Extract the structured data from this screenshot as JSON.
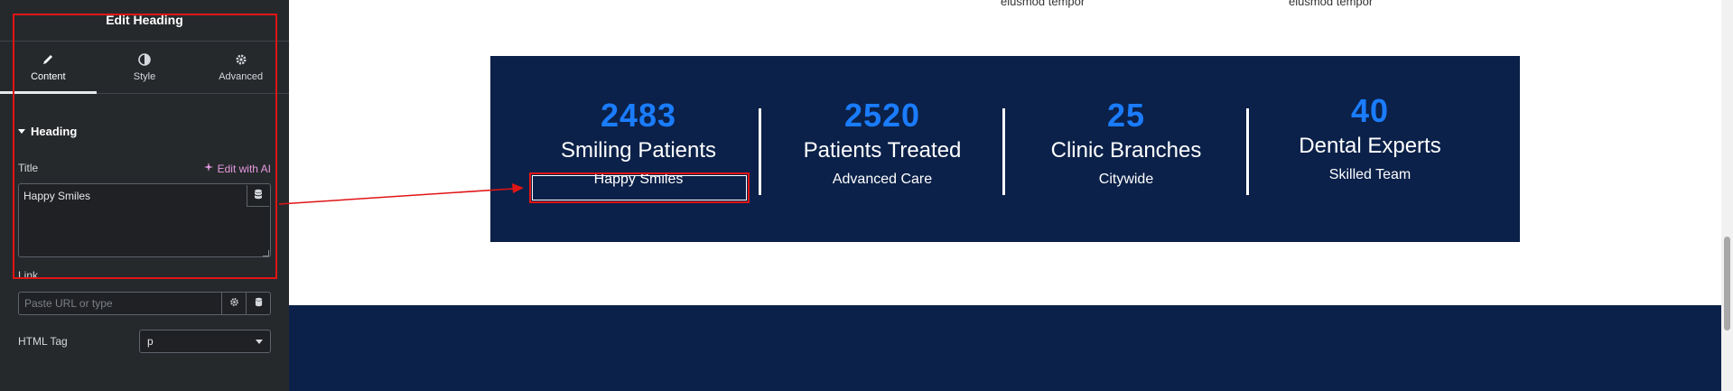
{
  "panel": {
    "header_title": "Edit Heading",
    "tabs": [
      {
        "label": "Content",
        "icon": "pencil-icon"
      },
      {
        "label": "Style",
        "icon": "half-circle-icon"
      },
      {
        "label": "Advanced",
        "icon": "gear-icon"
      }
    ],
    "section_title": "Heading",
    "title_label": "Title",
    "edit_with_ai": "Edit with AI",
    "title_value": "Happy Smiles",
    "link_label": "Link",
    "link_placeholder": "Paste URL or type",
    "html_tag_label": "HTML Tag",
    "html_tag_value": "p"
  },
  "canvas": {
    "top_text_left": "eiusmod tempor",
    "top_text_right": "eiusmod tempor",
    "stats": [
      {
        "number": "2483",
        "label": "Smiling Patients",
        "sub": "Happy Smiles"
      },
      {
        "number": "2520",
        "label": "Patients Treated",
        "sub": "Advanced Care"
      },
      {
        "number": "25",
        "label": "Clinic Branches",
        "sub": "Citywide"
      },
      {
        "number": "40",
        "label": "Dental Experts",
        "sub": "Skilled Team"
      }
    ]
  },
  "colors": {
    "panel_bg": "#26292c",
    "stats_bg": "#0b2149",
    "number_blue": "#1a7cff",
    "annotation_red": "#e01515",
    "ai_pink": "#e59adf"
  }
}
